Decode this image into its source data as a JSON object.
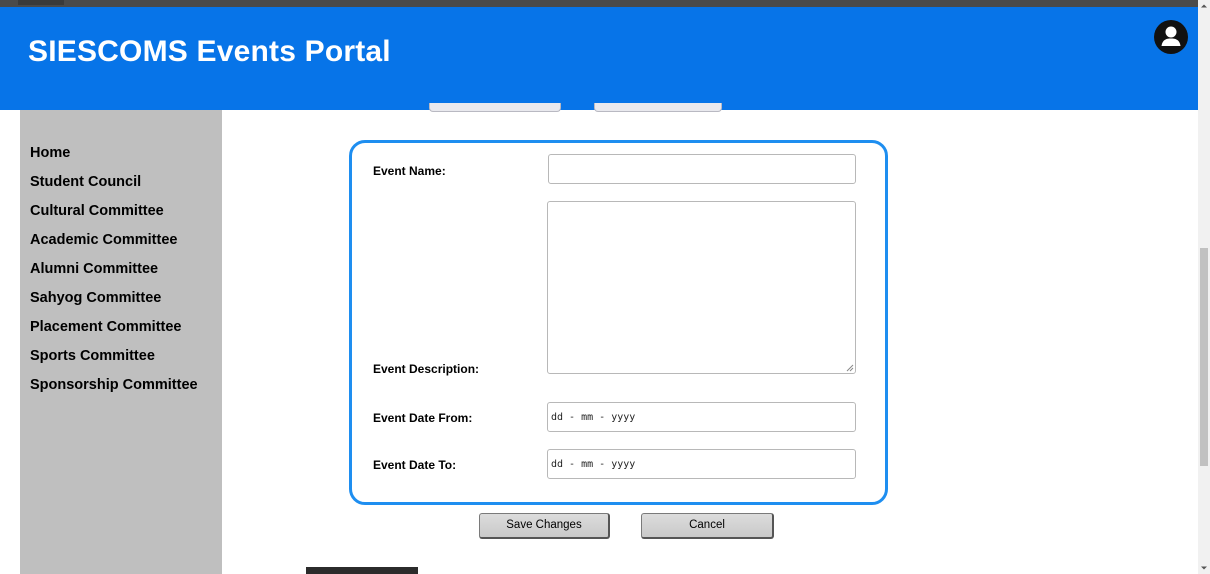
{
  "header": {
    "title": "SIESCOMS Events Portal",
    "profile_icon": "user-icon"
  },
  "sidebar": {
    "items": [
      {
        "label": "Home"
      },
      {
        "label": "Student Council"
      },
      {
        "label": "Cultural Committee"
      },
      {
        "label": "Academic Committee"
      },
      {
        "label": "Alumni Committee"
      },
      {
        "label": "Sahyog Committee"
      },
      {
        "label": "Placement Committee"
      },
      {
        "label": "Sports Committee"
      },
      {
        "label": "Sponsorship Committee"
      }
    ]
  },
  "form": {
    "event_name_label": "Event Name:",
    "event_name_value": "",
    "event_description_label": "Event Description:",
    "event_description_value": "",
    "date_from_label": "Event Date From:",
    "date_from_value": "dd - mm - yyyy",
    "date_to_label": "Event Date To:",
    "date_to_value": "dd - mm - yyyy"
  },
  "actions": {
    "save_label": "Save Changes",
    "cancel_label": "Cancel"
  },
  "colors": {
    "header_bg": "#0774e8",
    "sidebar_bg": "#bfbfbf",
    "form_border": "#1e8ef0"
  }
}
